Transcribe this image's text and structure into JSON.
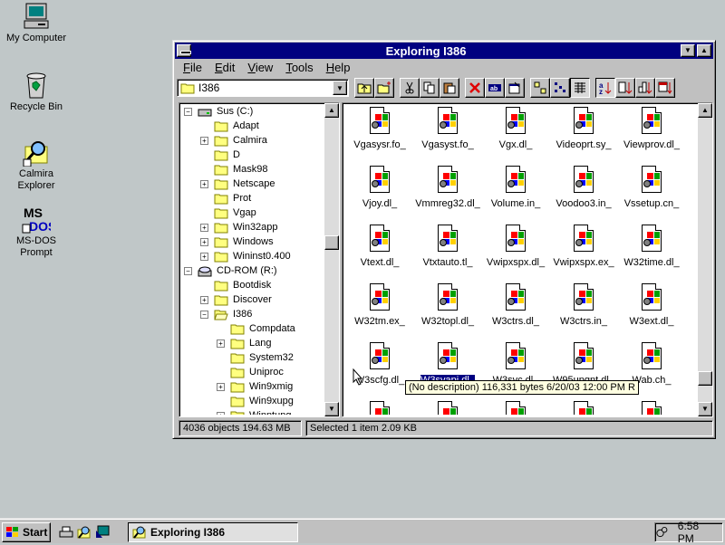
{
  "desktop": {
    "icons": [
      {
        "label": "My Computer",
        "icon": "computer-icon"
      },
      {
        "label": "Recycle Bin",
        "icon": "recycle-bin-icon"
      },
      {
        "label": "Calmira Explorer",
        "icon": "magnifier-folder-icon"
      },
      {
        "label": "MS-DOS Prompt",
        "icon": "msdos-icon"
      }
    ]
  },
  "window": {
    "title": "Exploring I386",
    "menu": [
      "File",
      "Edit",
      "View",
      "Tools",
      "Help"
    ],
    "address": "I386",
    "toolbar_icons": [
      "up-folder-icon",
      "new-folder-icon",
      "cut-icon",
      "copy-icon",
      "paste-icon",
      "delete-icon",
      "rename-icon",
      "properties-icon",
      "large-icons-icon",
      "small-icons-icon",
      "details-icon",
      "sort-name-icon",
      "sort-type-icon",
      "sort-size-icon",
      "sort-date-icon"
    ],
    "tree": [
      {
        "label": "Sus (C:)",
        "level": 0,
        "type": "drive",
        "expander": "-"
      },
      {
        "label": "Adapt",
        "level": 1,
        "type": "folder",
        "expander": ""
      },
      {
        "label": "Calmira",
        "level": 1,
        "type": "folder",
        "expander": "+"
      },
      {
        "label": "D",
        "level": 1,
        "type": "folder",
        "expander": ""
      },
      {
        "label": "Mask98",
        "level": 1,
        "type": "folder",
        "expander": ""
      },
      {
        "label": "Netscape",
        "level": 1,
        "type": "folder",
        "expander": "+"
      },
      {
        "label": "Prot",
        "level": 1,
        "type": "folder",
        "expander": ""
      },
      {
        "label": "Vgap",
        "level": 1,
        "type": "folder",
        "expander": ""
      },
      {
        "label": "Win32app",
        "level": 1,
        "type": "folder",
        "expander": "+"
      },
      {
        "label": "Windows",
        "level": 1,
        "type": "folder",
        "expander": "+"
      },
      {
        "label": "Wininst0.400",
        "level": 1,
        "type": "folder",
        "expander": "+"
      },
      {
        "label": "CD-ROM (R:)",
        "level": 0,
        "type": "cdrom",
        "expander": "-"
      },
      {
        "label": "Bootdisk",
        "level": 1,
        "type": "folder",
        "expander": ""
      },
      {
        "label": "Discover",
        "level": 1,
        "type": "folder",
        "expander": "+"
      },
      {
        "label": "I386",
        "level": 1,
        "type": "openfolder",
        "expander": "-"
      },
      {
        "label": "Compdata",
        "level": 2,
        "type": "folder",
        "expander": ""
      },
      {
        "label": "Lang",
        "level": 2,
        "type": "folder",
        "expander": "+"
      },
      {
        "label": "System32",
        "level": 2,
        "type": "folder",
        "expander": ""
      },
      {
        "label": "Uniproc",
        "level": 2,
        "type": "folder",
        "expander": ""
      },
      {
        "label": "Win9xmig",
        "level": 2,
        "type": "folder",
        "expander": "+"
      },
      {
        "label": "Win9xupg",
        "level": 2,
        "type": "folder",
        "expander": ""
      },
      {
        "label": "Winntupg",
        "level": 2,
        "type": "folder",
        "expander": "+"
      }
    ],
    "files": [
      "Vgasysr.fo_",
      "Vgasyst.fo_",
      "Vgx.dl_",
      "Videoprt.sy_",
      "Viewprov.dl_",
      "Vjoy.dl_",
      "Vmmreg32.dl_",
      "Volume.in_",
      "Voodoo3.in_",
      "Vssetup.cn_",
      "Vtext.dl_",
      "Vtxtauto.tl_",
      "Vwipxspx.dl_",
      "Vwipxspx.ex_",
      "W32time.dl_",
      "W32tm.ex_",
      "W32topl.dl_",
      "W3ctrs.dl_",
      "W3ctrs.in_",
      "W3ext.dl_",
      "W3scfg.dl_",
      "W3svapi.dl_",
      "W3svc.dl_",
      "W95upgnt.dl_",
      "Wab.ch_"
    ],
    "selected_file": "W3svapi.dl_",
    "tooltip": "(No description)  116,331 bytes  6/20/03  12:00 PM  R",
    "status": {
      "objects": "4036 objects  194.63 MB",
      "selection": "Selected 1 item  2.09 KB"
    }
  },
  "taskbar": {
    "start_label": "Start",
    "task_label": "Exploring I386",
    "clock": "6:58 PM"
  }
}
